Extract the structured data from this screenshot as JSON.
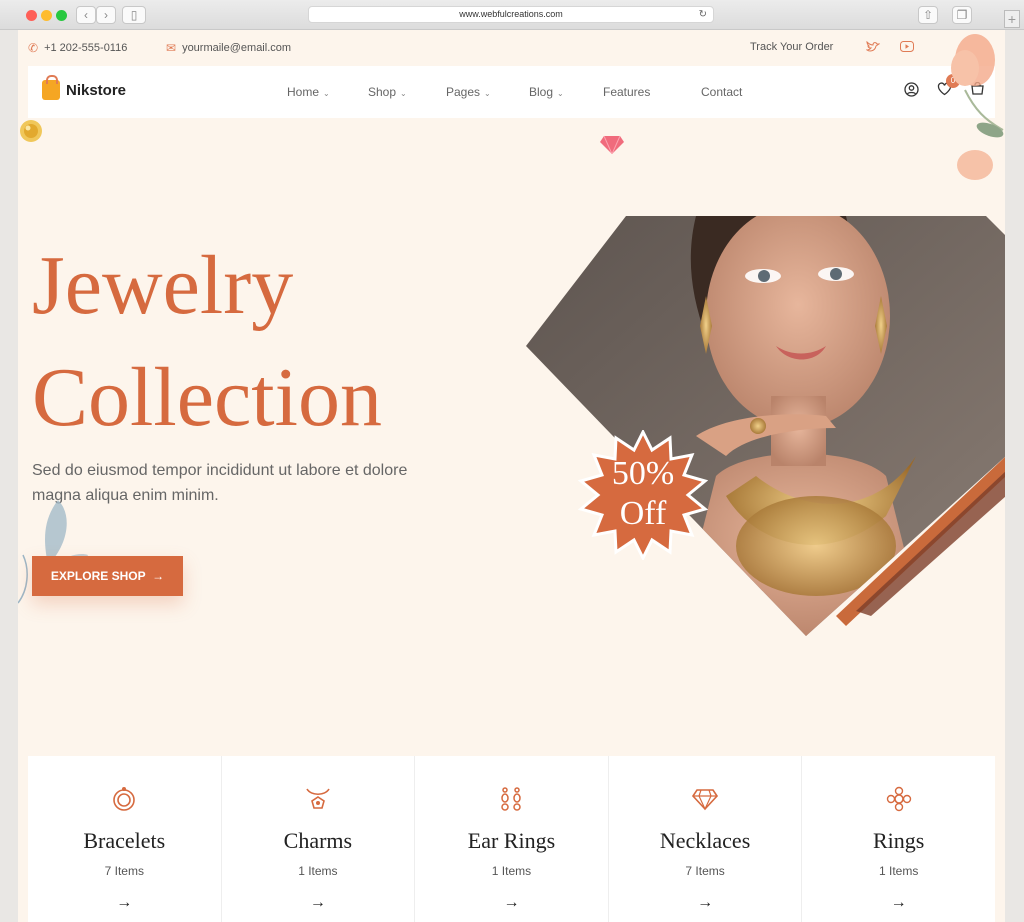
{
  "browser": {
    "url": "www.webfulcreations.com"
  },
  "topbar": {
    "phone": "+1 202-555-0116",
    "email": "yourmaile@email.com",
    "track": "Track Your Order"
  },
  "header": {
    "brand": "Nikstore",
    "nav": [
      {
        "label": "Home"
      },
      {
        "label": "Shop"
      },
      {
        "label": "Pages"
      },
      {
        "label": "Blog"
      },
      {
        "label": "Features"
      },
      {
        "label": "Contact"
      }
    ],
    "wishlist_count": "0"
  },
  "hero": {
    "title_line1": "Jewelry",
    "title_line2": "Collection",
    "description": "Sed do eiusmod tempor incididunt ut labore et dolore magna aliqua enim minim.",
    "cta": "EXPLORE SHOP",
    "badge_line1": "50%",
    "badge_line2": "Off"
  },
  "categories": [
    {
      "name": "Bracelets",
      "count": "7 Items",
      "icon": "bracelet-icon"
    },
    {
      "name": "Charms",
      "count": "1 Items",
      "icon": "charm-icon"
    },
    {
      "name": "Ear Rings",
      "count": "1 Items",
      "icon": "earring-icon"
    },
    {
      "name": "Necklaces",
      "count": "7 Items",
      "icon": "diamond-icon"
    },
    {
      "name": "Rings",
      "count": "1 Items",
      "icon": "ring-icon"
    }
  ],
  "colors": {
    "accent": "#d66a3f",
    "page_bg": "#fdf5ec"
  }
}
